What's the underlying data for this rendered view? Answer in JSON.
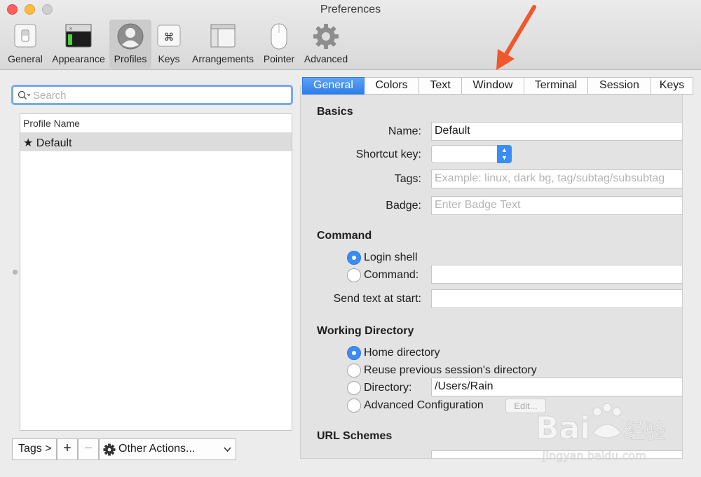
{
  "window": {
    "title": "Preferences"
  },
  "toolbar": {
    "items": [
      {
        "label": "General",
        "icon": "switch-icon"
      },
      {
        "label": "Appearance",
        "icon": "terminal-window-icon"
      },
      {
        "label": "Profiles",
        "icon": "person-icon",
        "active": true
      },
      {
        "label": "Keys",
        "icon": "command-key-icon"
      },
      {
        "label": "Arrangements",
        "icon": "window-arrangement-icon"
      },
      {
        "label": "Pointer",
        "icon": "mouse-icon"
      },
      {
        "label": "Advanced",
        "icon": "gear-icon"
      }
    ]
  },
  "left": {
    "search": {
      "placeholder": "Search"
    },
    "list": {
      "header": "Profile Name",
      "rows": [
        {
          "name": "★ Default"
        }
      ]
    },
    "bottom": {
      "tags": "Tags >",
      "add": "+",
      "remove": "−",
      "other_actions": "Other Actions..."
    }
  },
  "tabs": [
    "General",
    "Colors",
    "Text",
    "Window",
    "Terminal",
    "Session",
    "Keys"
  ],
  "basics": {
    "title": "Basics",
    "name_label": "Name:",
    "name_value": "Default",
    "shortcut_label": "Shortcut key:",
    "tags_label": "Tags:",
    "tags_placeholder": "Example: linux, dark bg, tag/subtag/subsubtag",
    "badge_label": "Badge:",
    "badge_placeholder": "Enter Badge Text"
  },
  "command": {
    "title": "Command",
    "login_shell": "Login shell",
    "command_label": "Command:",
    "send_text_label": "Send text at start:"
  },
  "working_directory": {
    "title": "Working Directory",
    "home": "Home directory",
    "reuse": "Reuse previous session's directory",
    "directory_label": "Directory:",
    "directory_value": "/Users/Rain",
    "advanced": "Advanced Configuration",
    "edit": "Edit..."
  },
  "url_schemes": {
    "title": "URL Schemes"
  },
  "colors": {
    "accent": "#3a8df3",
    "annotation_arrow": "#f2562b"
  }
}
